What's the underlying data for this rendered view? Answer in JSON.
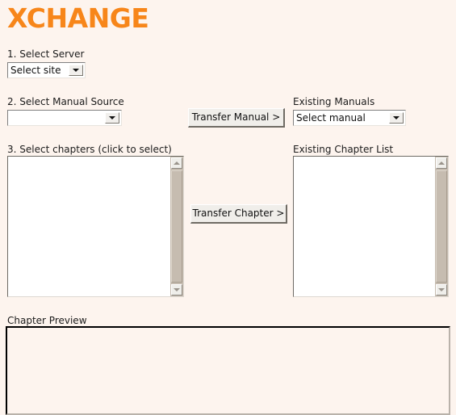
{
  "app": {
    "brand": "XCHANGE",
    "background_color": "#fdf4ee",
    "brand_color": "#f7861a"
  },
  "steps": {
    "step1": {
      "label": "1. Select Server",
      "server_select": {
        "value": "Select site",
        "icon": "chevron-down-icon"
      }
    },
    "step2": {
      "label": "2. Select Manual Source",
      "manual_source_select": {
        "value": "",
        "icon": "chevron-down-icon"
      }
    },
    "step3": {
      "label": "3. Select chapters (click to select)",
      "chapter_list": {
        "items": [],
        "scrollbar": {
          "up_icon": "triangle-up-icon",
          "down_icon": "triangle-down-icon"
        }
      }
    }
  },
  "actions": {
    "transfer_manual": "Transfer Manual >",
    "transfer_chapter": "Transfer Chapter >"
  },
  "existing": {
    "manuals_label": "Existing Manuals",
    "manuals_select": {
      "value": "Select manual",
      "icon": "chevron-down-icon"
    },
    "chapter_list_label": "Existing Chapter List",
    "chapter_list": {
      "items": [],
      "scrollbar": {
        "up_icon": "triangle-up-icon",
        "down_icon": "triangle-down-icon"
      }
    }
  },
  "preview": {
    "label": "Chapter Preview",
    "content": ""
  }
}
